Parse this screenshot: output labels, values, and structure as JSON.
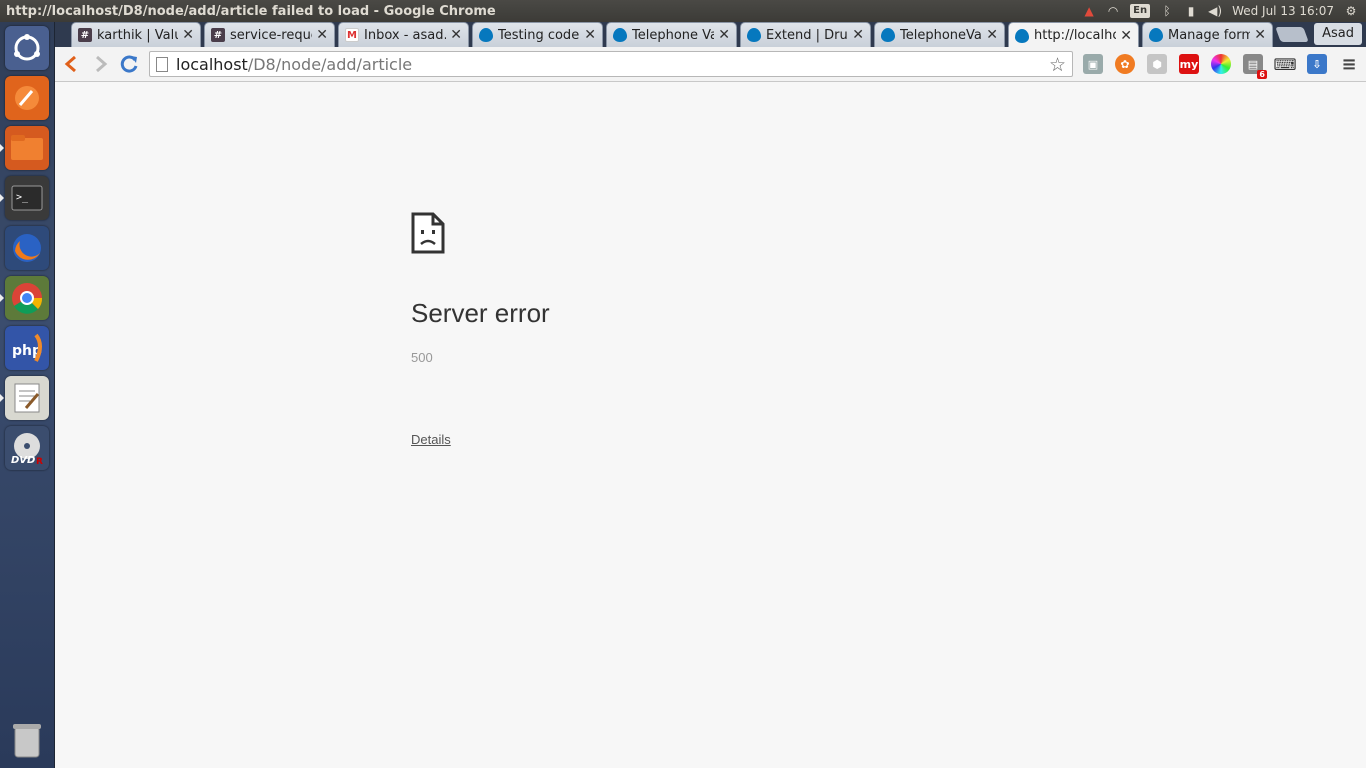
{
  "window": {
    "title": "http://localhost/D8/node/add/article failed to load - Google Chrome"
  },
  "tray": {
    "lang": "En",
    "datetime": "Wed Jul 13 16:07"
  },
  "launcher": {
    "items": [
      "ubuntu-dash-icon",
      "scratchpad-icon",
      "files-icon",
      "terminal-icon",
      "firefox-icon",
      "chrome-icon",
      "phpstorm-icon",
      "text-editor-icon",
      "dvd-icon",
      "trash-icon"
    ]
  },
  "tabs": [
    {
      "title": "karthik | Valu",
      "favicon": "#"
    },
    {
      "title": "service-reque",
      "favicon": "#"
    },
    {
      "title": "Inbox - asad.k",
      "favicon": "M"
    },
    {
      "title": "Testing code |",
      "favicon": ""
    },
    {
      "title": "Telephone Va",
      "favicon": ""
    },
    {
      "title": "Extend | Drup",
      "favicon": ""
    },
    {
      "title": "TelephoneVal",
      "favicon": ""
    },
    {
      "title": "http://localho",
      "favicon": ""
    },
    {
      "title": "Manage form",
      "favicon": ""
    }
  ],
  "profile": {
    "name": "Asad"
  },
  "omnibox": {
    "host": "localhost",
    "path": "/D8/node/add/article"
  },
  "extensions": {
    "badge_count": "6",
    "my_label": "my"
  },
  "error": {
    "title": "Server error",
    "code": "500",
    "details_label": "Details"
  },
  "colors": {
    "accent_blue": "#3b78c9",
    "launcher_bg": "#2f3d57",
    "error_text": "#333333"
  }
}
